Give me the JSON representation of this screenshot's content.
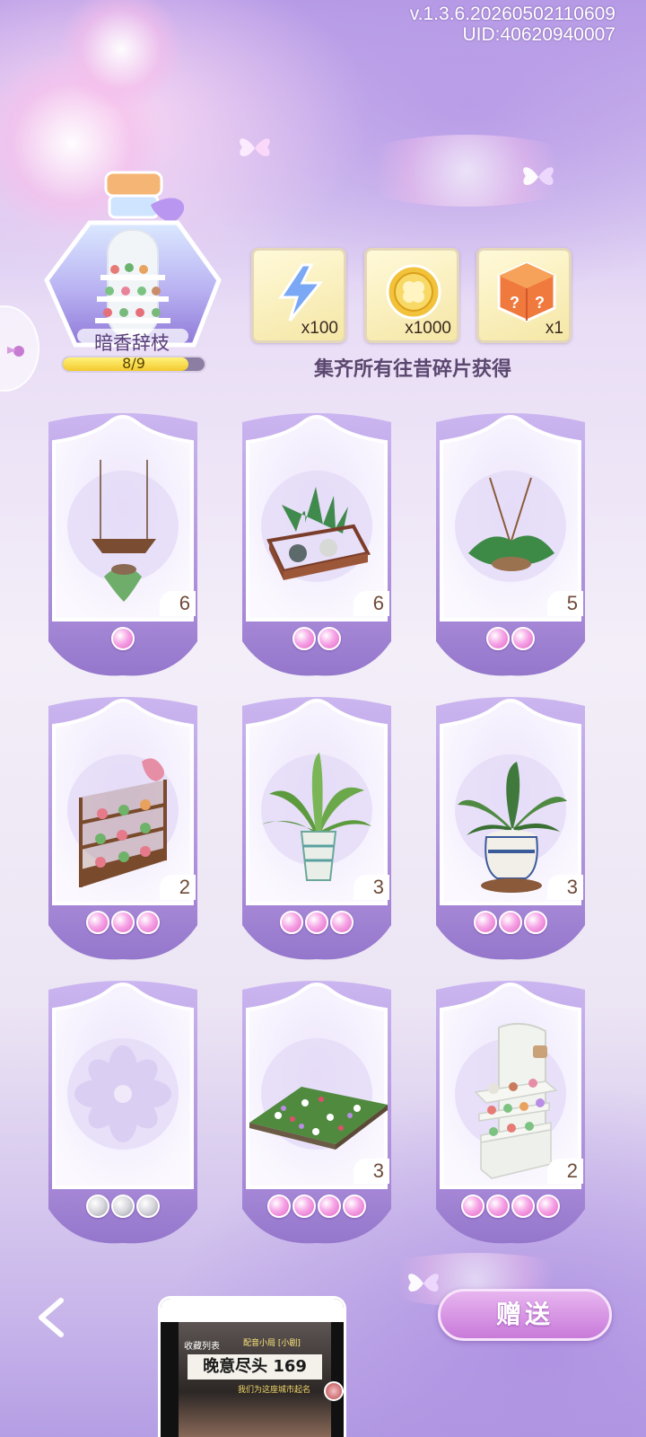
{
  "header": {
    "version": "v.1.3.6.20260502110609",
    "uid": "UID:40620940007"
  },
  "collection": {
    "name": "暗香辞枝",
    "progress_text": "8/9",
    "progress_fraction": 0.889
  },
  "rewards": [
    {
      "icon": "lightning-icon",
      "qty": "x100"
    },
    {
      "icon": "coin-icon",
      "qty": "x1000"
    },
    {
      "icon": "mystery-box-icon",
      "qty": "x1"
    }
  ],
  "rewards_caption": "集齐所有往昔碎片获得",
  "cards": [
    {
      "item": "hanging-shelf-plant",
      "count": "6",
      "orbs": 1,
      "orb_color": "pink"
    },
    {
      "item": "glass-terrarium-plants",
      "count": "6",
      "orbs": 2,
      "orb_color": "pink"
    },
    {
      "item": "hanging-fern-basket",
      "count": "5",
      "orbs": 2,
      "orb_color": "pink"
    },
    {
      "item": "flower-display-shelf",
      "count": "2",
      "orbs": 3,
      "orb_color": "pink"
    },
    {
      "item": "potted-spider-plant",
      "count": "3",
      "orbs": 3,
      "orb_color": "pink"
    },
    {
      "item": "porcelain-potted-plant",
      "count": "3",
      "orbs": 3,
      "orb_color": "pink"
    },
    {
      "item": "locked-empty-card",
      "count": "",
      "orbs": 3,
      "orb_color": "gray"
    },
    {
      "item": "flower-bed-patch",
      "count": "3",
      "orbs": 4,
      "orb_color": "pink"
    },
    {
      "item": "white-flower-cabinet",
      "count": "2",
      "orbs": 4,
      "orb_color": "pink"
    }
  ],
  "bottom": {
    "give_label": "赠送"
  },
  "mini_player": {
    "list_label": "收藏列表",
    "tag_label": "配音小局 [小剧]",
    "title": "晚意尽头 169",
    "subtitle": "我们为这座城市起名"
  },
  "colors": {
    "accent_purple": "#a98ad8",
    "orb_pink": "#f6a5e6",
    "orb_gray": "#c8c8d0",
    "give_button": "#d08cdf"
  }
}
